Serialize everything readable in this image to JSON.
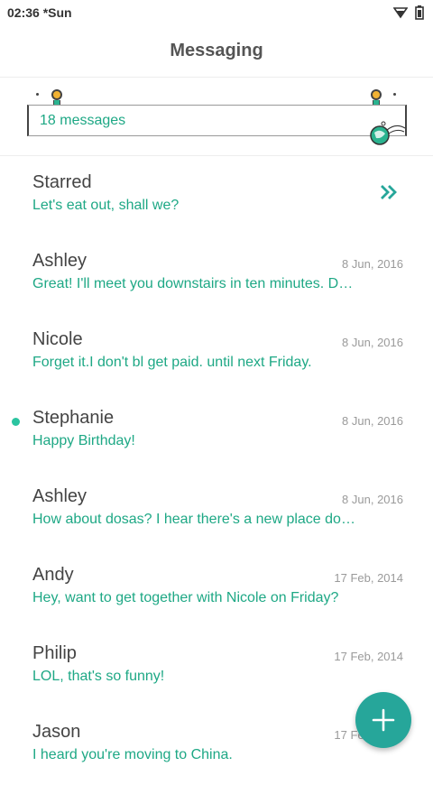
{
  "status_bar": {
    "time": "02:36 *Sun",
    "icons": [
      "wifi-icon",
      "battery-icon"
    ]
  },
  "app_bar": {
    "title": "Messaging"
  },
  "banner": {
    "count_text": "18 messages",
    "accent": "#1ea885"
  },
  "conversations": [
    {
      "name": "Starred",
      "date": "",
      "preview": "Let's eat out, shall we?",
      "unread": false,
      "action_icon": "double-chevron-right-icon"
    },
    {
      "name": "Ashley",
      "date": "8 Jun, 2016",
      "preview": "Great! I'll meet you downstairs in ten minutes. D…",
      "unread": false
    },
    {
      "name": "Nicole",
      "date": "8 Jun, 2016",
      "preview": "Forget it.I don't bl get paid. until next Friday.",
      "unread": false
    },
    {
      "name": "Stephanie",
      "date": "8 Jun, 2016",
      "preview": "Happy Birthday!",
      "unread": true
    },
    {
      "name": "Ashley",
      "date": "8 Jun, 2016",
      "preview": "How about dosas? I hear there's a new place do…",
      "unread": false
    },
    {
      "name": "Andy",
      "date": "17 Feb, 2014",
      "preview": "Hey, want to get together with Nicole on Friday?",
      "unread": false
    },
    {
      "name": "Philip",
      "date": "17 Feb, 2014",
      "preview": "LOL, that's so funny!",
      "unread": false
    },
    {
      "name": "Jason",
      "date": "17 Feb, 2014",
      "preview": "I heard you're moving to China.",
      "unread": false
    }
  ],
  "fab": {
    "icon": "plus-icon",
    "color": "#26a69a"
  }
}
